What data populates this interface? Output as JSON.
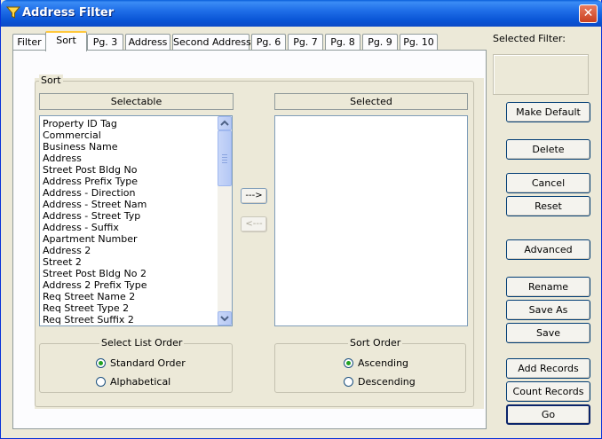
{
  "window": {
    "title": "Address Filter",
    "icon": "filter-funnel-icon",
    "close_glyph": "✕"
  },
  "tabs": [
    {
      "label": "Filter",
      "active": false
    },
    {
      "label": "Sort",
      "active": true
    },
    {
      "label": "Pg. 3",
      "active": false
    },
    {
      "label": "Address",
      "active": false
    },
    {
      "label": "Second Address",
      "active": false
    },
    {
      "label": "Pg. 6",
      "active": false
    },
    {
      "label": "Pg. 7",
      "active": false
    },
    {
      "label": "Pg. 8",
      "active": false
    },
    {
      "label": "Pg. 9",
      "active": false
    },
    {
      "label": "Pg. 10",
      "active": false
    }
  ],
  "sort_group": {
    "label": "Sort",
    "selectable_header": "Selectable",
    "selected_header": "Selected",
    "selectable_items": [
      "Property ID Tag",
      "Commercial",
      "Business Name",
      "Address",
      "Street Post Bldg No",
      "Address Prefix Type",
      "Address - Direction",
      "Address - Street Nam",
      "Address - Street Typ",
      "Address - Suffix",
      "Apartment Number",
      "Address 2",
      "Street 2",
      "Street Post Bldg No 2",
      "Address 2 Prefix Type",
      "Req Street Name 2",
      "Req Street Type 2",
      "Req Street Suffix 2"
    ],
    "selected_items": [],
    "add_button": "--->",
    "remove_button": "<---",
    "add_enabled": true,
    "remove_enabled": false
  },
  "list_order": {
    "label": "Select List Order",
    "options": [
      "Standard Order",
      "Alphabetical"
    ],
    "selected": "Standard Order"
  },
  "sort_order": {
    "label": "Sort Order",
    "options": [
      "Ascending",
      "Descending"
    ],
    "selected": "Ascending"
  },
  "right_panel": {
    "selected_filter_label": "Selected Filter:",
    "selected_filter_value": "",
    "buttons": {
      "make_default": "Make Default",
      "delete": "Delete",
      "cancel": "Cancel",
      "reset": "Reset",
      "advanced": "Advanced",
      "rename": "Rename",
      "save_as": "Save As",
      "save": "Save",
      "add_records": "Add Records",
      "count_records": "Count Records",
      "go": "Go"
    }
  },
  "colors": {
    "titlebar": "#0a55d6",
    "dialog_bg": "#ece9d8",
    "tab_highlight": "#ffc83c",
    "close_button": "#c9401f",
    "radio_dot": "#21a121"
  }
}
